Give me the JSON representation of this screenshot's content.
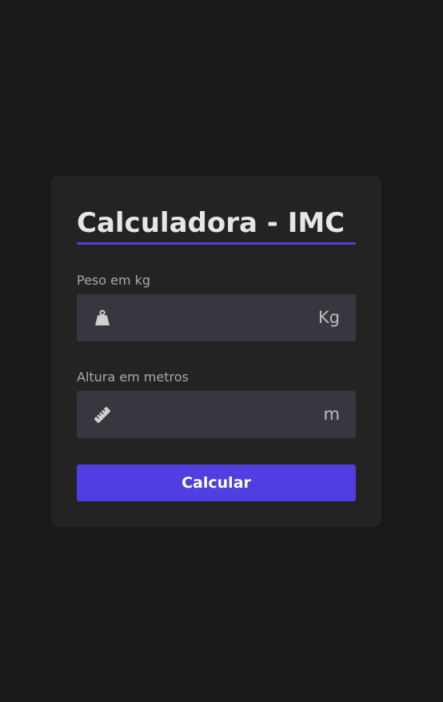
{
  "form": {
    "title": "Calculadora - IMC",
    "weight": {
      "label": "Peso em kg",
      "value": "",
      "unit": "Kg",
      "icon": "weight-icon"
    },
    "height": {
      "label": "Altura em metros",
      "value": "",
      "unit": "m",
      "icon": "ruler-icon"
    },
    "submit_label": "Calcular"
  },
  "colors": {
    "page_background": "#191919",
    "card_background": "#232323",
    "input_background": "#38373f",
    "accent": "#4f3fe0",
    "title_text": "#e6e6e6",
    "label_text": "#a9a9a9"
  }
}
